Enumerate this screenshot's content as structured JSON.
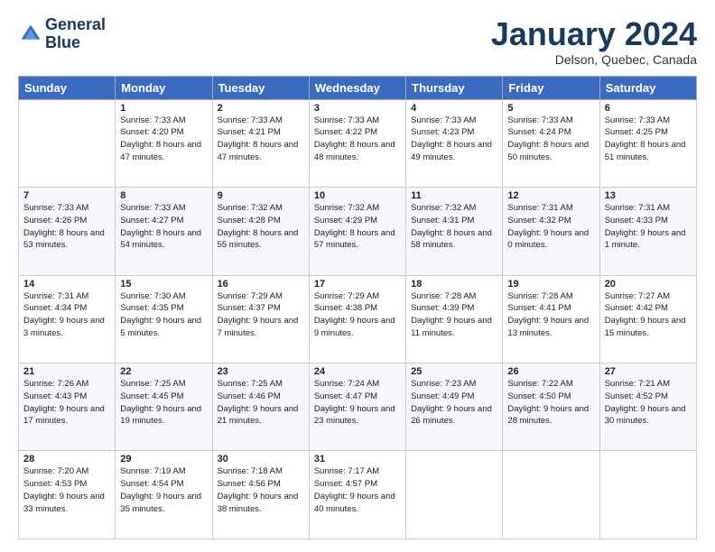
{
  "header": {
    "logo_line1": "General",
    "logo_line2": "Blue",
    "month": "January 2024",
    "location": "Delson, Quebec, Canada"
  },
  "weekdays": [
    "Sunday",
    "Monday",
    "Tuesday",
    "Wednesday",
    "Thursday",
    "Friday",
    "Saturday"
  ],
  "weeks": [
    [
      {
        "day": "",
        "sunrise": "",
        "sunset": "",
        "daylight": ""
      },
      {
        "day": "1",
        "sunrise": "Sunrise: 7:33 AM",
        "sunset": "Sunset: 4:20 PM",
        "daylight": "Daylight: 8 hours and 47 minutes."
      },
      {
        "day": "2",
        "sunrise": "Sunrise: 7:33 AM",
        "sunset": "Sunset: 4:21 PM",
        "daylight": "Daylight: 8 hours and 47 minutes."
      },
      {
        "day": "3",
        "sunrise": "Sunrise: 7:33 AM",
        "sunset": "Sunset: 4:22 PM",
        "daylight": "Daylight: 8 hours and 48 minutes."
      },
      {
        "day": "4",
        "sunrise": "Sunrise: 7:33 AM",
        "sunset": "Sunset: 4:23 PM",
        "daylight": "Daylight: 8 hours and 49 minutes."
      },
      {
        "day": "5",
        "sunrise": "Sunrise: 7:33 AM",
        "sunset": "Sunset: 4:24 PM",
        "daylight": "Daylight: 8 hours and 50 minutes."
      },
      {
        "day": "6",
        "sunrise": "Sunrise: 7:33 AM",
        "sunset": "Sunset: 4:25 PM",
        "daylight": "Daylight: 8 hours and 51 minutes."
      }
    ],
    [
      {
        "day": "7",
        "sunrise": "Sunrise: 7:33 AM",
        "sunset": "Sunset: 4:26 PM",
        "daylight": "Daylight: 8 hours and 53 minutes."
      },
      {
        "day": "8",
        "sunrise": "Sunrise: 7:33 AM",
        "sunset": "Sunset: 4:27 PM",
        "daylight": "Daylight: 8 hours and 54 minutes."
      },
      {
        "day": "9",
        "sunrise": "Sunrise: 7:32 AM",
        "sunset": "Sunset: 4:28 PM",
        "daylight": "Daylight: 8 hours and 55 minutes."
      },
      {
        "day": "10",
        "sunrise": "Sunrise: 7:32 AM",
        "sunset": "Sunset: 4:29 PM",
        "daylight": "Daylight: 8 hours and 57 minutes."
      },
      {
        "day": "11",
        "sunrise": "Sunrise: 7:32 AM",
        "sunset": "Sunset: 4:31 PM",
        "daylight": "Daylight: 8 hours and 58 minutes."
      },
      {
        "day": "12",
        "sunrise": "Sunrise: 7:31 AM",
        "sunset": "Sunset: 4:32 PM",
        "daylight": "Daylight: 9 hours and 0 minutes."
      },
      {
        "day": "13",
        "sunrise": "Sunrise: 7:31 AM",
        "sunset": "Sunset: 4:33 PM",
        "daylight": "Daylight: 9 hours and 1 minute."
      }
    ],
    [
      {
        "day": "14",
        "sunrise": "Sunrise: 7:31 AM",
        "sunset": "Sunset: 4:34 PM",
        "daylight": "Daylight: 9 hours and 3 minutes."
      },
      {
        "day": "15",
        "sunrise": "Sunrise: 7:30 AM",
        "sunset": "Sunset: 4:35 PM",
        "daylight": "Daylight: 9 hours and 5 minutes."
      },
      {
        "day": "16",
        "sunrise": "Sunrise: 7:29 AM",
        "sunset": "Sunset: 4:37 PM",
        "daylight": "Daylight: 9 hours and 7 minutes."
      },
      {
        "day": "17",
        "sunrise": "Sunrise: 7:29 AM",
        "sunset": "Sunset: 4:38 PM",
        "daylight": "Daylight: 9 hours and 9 minutes."
      },
      {
        "day": "18",
        "sunrise": "Sunrise: 7:28 AM",
        "sunset": "Sunset: 4:39 PM",
        "daylight": "Daylight: 9 hours and 11 minutes."
      },
      {
        "day": "19",
        "sunrise": "Sunrise: 7:28 AM",
        "sunset": "Sunset: 4:41 PM",
        "daylight": "Daylight: 9 hours and 13 minutes."
      },
      {
        "day": "20",
        "sunrise": "Sunrise: 7:27 AM",
        "sunset": "Sunset: 4:42 PM",
        "daylight": "Daylight: 9 hours and 15 minutes."
      }
    ],
    [
      {
        "day": "21",
        "sunrise": "Sunrise: 7:26 AM",
        "sunset": "Sunset: 4:43 PM",
        "daylight": "Daylight: 9 hours and 17 minutes."
      },
      {
        "day": "22",
        "sunrise": "Sunrise: 7:25 AM",
        "sunset": "Sunset: 4:45 PM",
        "daylight": "Daylight: 9 hours and 19 minutes."
      },
      {
        "day": "23",
        "sunrise": "Sunrise: 7:25 AM",
        "sunset": "Sunset: 4:46 PM",
        "daylight": "Daylight: 9 hours and 21 minutes."
      },
      {
        "day": "24",
        "sunrise": "Sunrise: 7:24 AM",
        "sunset": "Sunset: 4:47 PM",
        "daylight": "Daylight: 9 hours and 23 minutes."
      },
      {
        "day": "25",
        "sunrise": "Sunrise: 7:23 AM",
        "sunset": "Sunset: 4:49 PM",
        "daylight": "Daylight: 9 hours and 26 minutes."
      },
      {
        "day": "26",
        "sunrise": "Sunrise: 7:22 AM",
        "sunset": "Sunset: 4:50 PM",
        "daylight": "Daylight: 9 hours and 28 minutes."
      },
      {
        "day": "27",
        "sunrise": "Sunrise: 7:21 AM",
        "sunset": "Sunset: 4:52 PM",
        "daylight": "Daylight: 9 hours and 30 minutes."
      }
    ],
    [
      {
        "day": "28",
        "sunrise": "Sunrise: 7:20 AM",
        "sunset": "Sunset: 4:53 PM",
        "daylight": "Daylight: 9 hours and 33 minutes."
      },
      {
        "day": "29",
        "sunrise": "Sunrise: 7:19 AM",
        "sunset": "Sunset: 4:54 PM",
        "daylight": "Daylight: 9 hours and 35 minutes."
      },
      {
        "day": "30",
        "sunrise": "Sunrise: 7:18 AM",
        "sunset": "Sunset: 4:56 PM",
        "daylight": "Daylight: 9 hours and 38 minutes."
      },
      {
        "day": "31",
        "sunrise": "Sunrise: 7:17 AM",
        "sunset": "Sunset: 4:57 PM",
        "daylight": "Daylight: 9 hours and 40 minutes."
      },
      {
        "day": "",
        "sunrise": "",
        "sunset": "",
        "daylight": ""
      },
      {
        "day": "",
        "sunrise": "",
        "sunset": "",
        "daylight": ""
      },
      {
        "day": "",
        "sunrise": "",
        "sunset": "",
        "daylight": ""
      }
    ]
  ]
}
